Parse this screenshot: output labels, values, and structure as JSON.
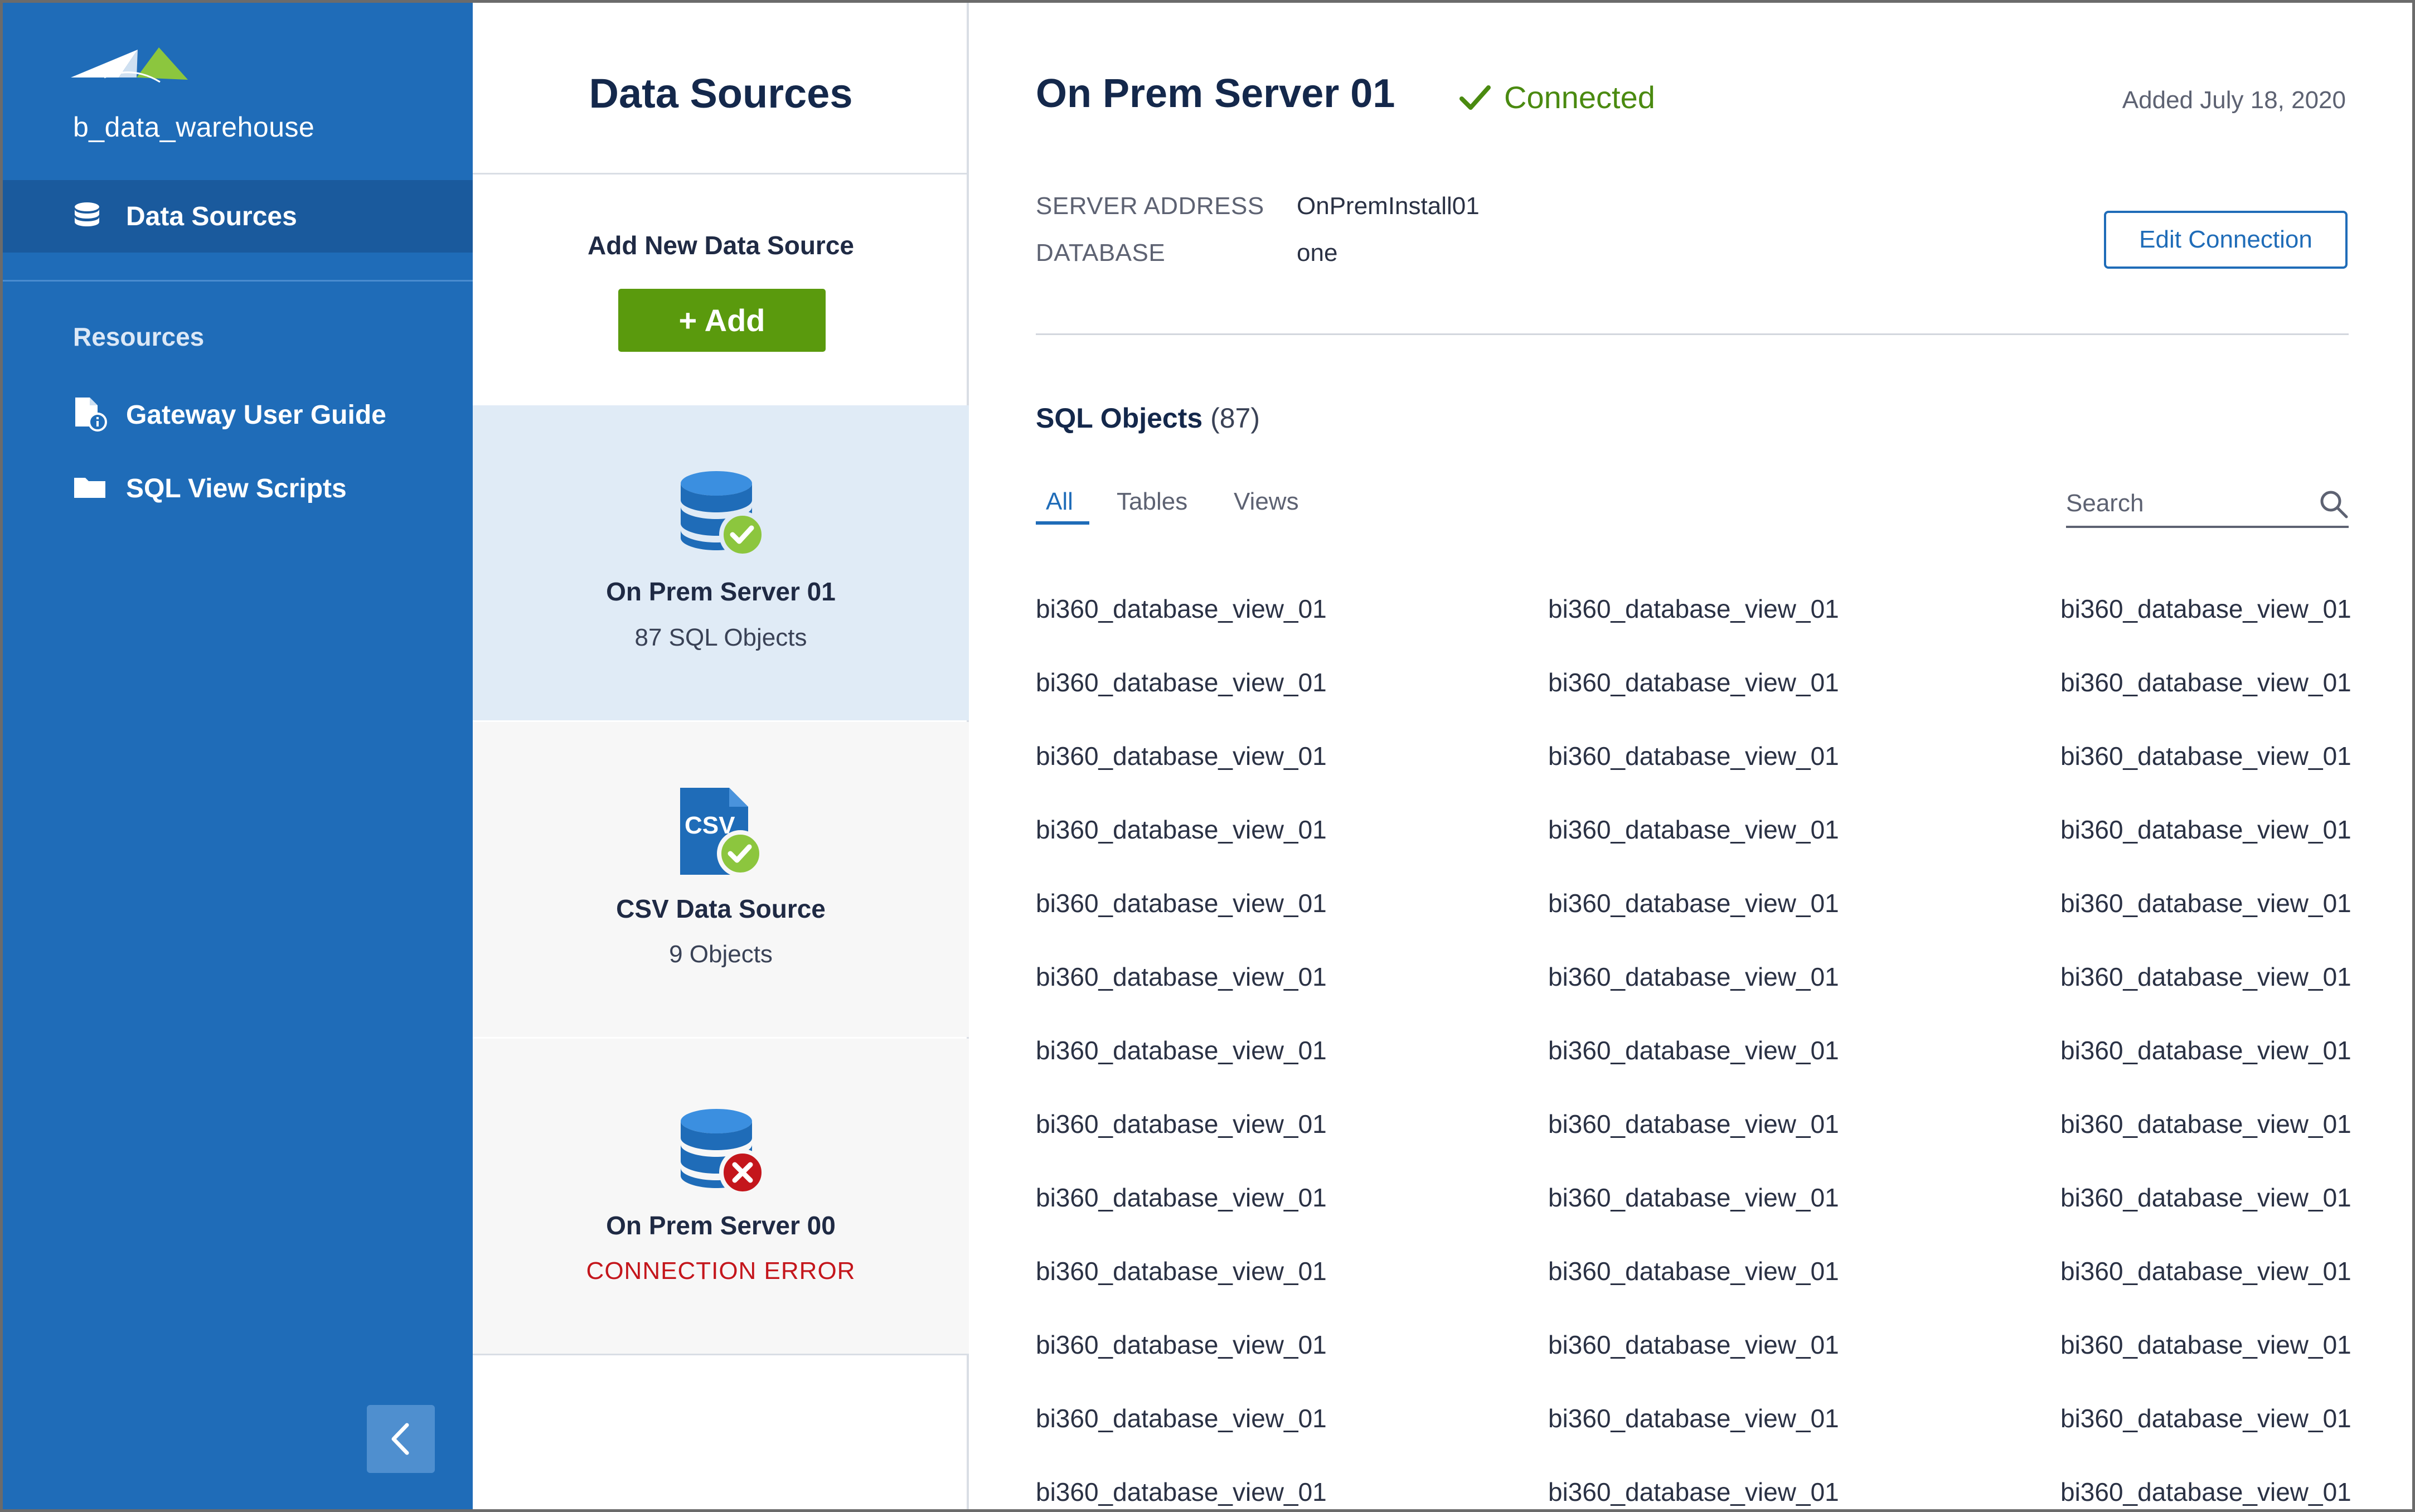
{
  "sidebar": {
    "brand": "b_data_warehouse",
    "nav_active": {
      "label": "Data Sources",
      "icon": "database-icon"
    },
    "resources_title": "Resources",
    "resources": [
      {
        "label": "Gateway User Guide",
        "icon": "document-info-icon"
      },
      {
        "label": "SQL View Scripts",
        "icon": "folder-icon"
      }
    ],
    "collapse_icon": "chevron-left-icon"
  },
  "middle": {
    "title": "Data Sources",
    "add_label": "Add New Data Source",
    "add_button": "+ Add",
    "sources": [
      {
        "name": "On Prem Server 01",
        "sub": "87 SQL Objects",
        "icon": "database-connected-icon",
        "status": "connected"
      },
      {
        "name": "CSV Data Source",
        "sub": "9 Objects",
        "icon": "csv-file-connected-icon",
        "icon_text": "CSV",
        "status": "connected"
      },
      {
        "name": "On Prem Server 00",
        "sub": "CONNECTION ERROR",
        "icon": "database-error-icon",
        "status": "error"
      }
    ]
  },
  "main": {
    "title": "On Prem Server 01",
    "status": "Connected",
    "added": "Added July 18, 2020",
    "server_address_key": "SERVER ADDRESS",
    "server_address_val": "OnPremInstall01",
    "database_key": "DATABASE",
    "database_val": "one",
    "edit_button": "Edit Connection",
    "sql_title": "SQL Objects",
    "sql_count": "(87)",
    "tabs": [
      "All",
      "Tables",
      "Views"
    ],
    "search_placeholder": "Search",
    "objects": [
      [
        "bi360_database_view_01",
        "bi360_database_view_01",
        "bi360_database_view_01"
      ],
      [
        "bi360_database_view_01",
        "bi360_database_view_01",
        "bi360_database_view_01"
      ],
      [
        "bi360_database_view_01",
        "bi360_database_view_01",
        "bi360_database_view_01"
      ],
      [
        "bi360_database_view_01",
        "bi360_database_view_01",
        "bi360_database_view_01"
      ],
      [
        "bi360_database_view_01",
        "bi360_database_view_01",
        "bi360_database_view_01"
      ],
      [
        "bi360_database_view_01",
        "bi360_database_view_01",
        "bi360_database_view_01"
      ],
      [
        "bi360_database_view_01",
        "bi360_database_view_01",
        "bi360_database_view_01"
      ],
      [
        "bi360_database_view_01",
        "bi360_database_view_01",
        "bi360_database_view_01"
      ],
      [
        "bi360_database_view_01",
        "bi360_database_view_01",
        "bi360_database_view_01"
      ],
      [
        "bi360_database_view_01",
        "bi360_database_view_01",
        "bi360_database_view_01"
      ],
      [
        "bi360_database_view_01",
        "bi360_database_view_01",
        "bi360_database_view_01"
      ],
      [
        "bi360_database_view_01",
        "bi360_database_view_01",
        "bi360_database_view_01"
      ],
      [
        "bi360_database_view_01",
        "bi360_database_view_01",
        "bi360_database_view_01"
      ]
    ]
  },
  "colors": {
    "sidebar": "#1f6cb8",
    "sidebar_active": "#1a5a9d",
    "accent": "#1f6cb8",
    "add_green": "#5a9a0d",
    "connected_green": "#4a8a10",
    "error_red": "#c4161c",
    "selected_card": "#e0ebf6"
  }
}
